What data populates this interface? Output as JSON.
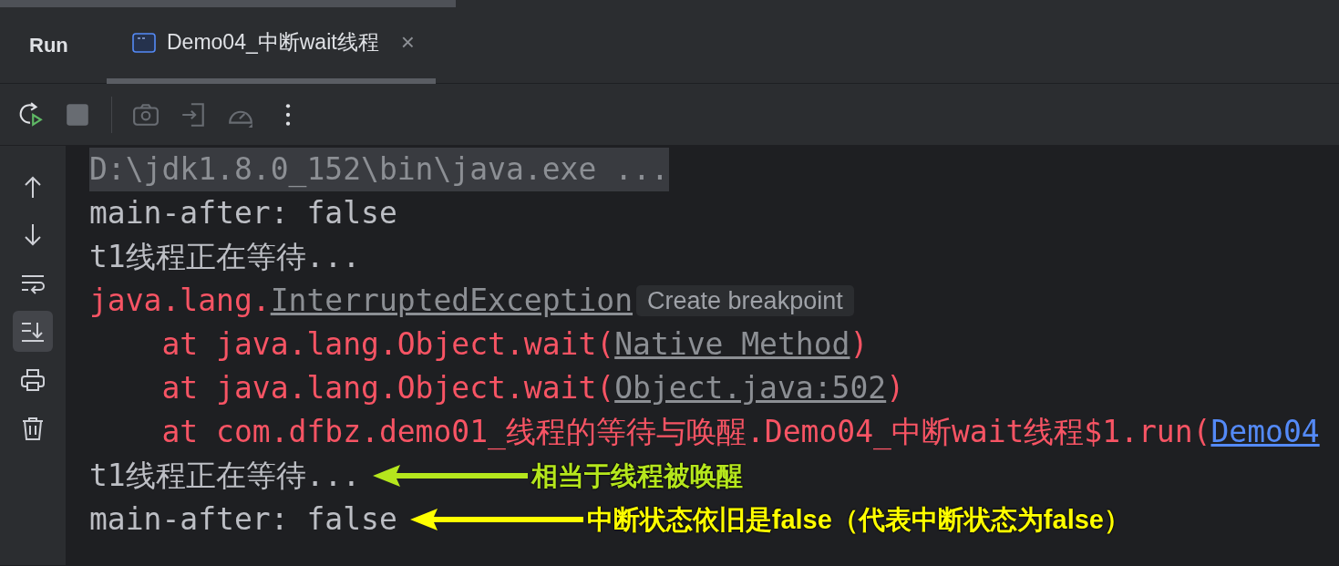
{
  "panel_title": "Run",
  "tabs": [
    {
      "label": "Demo04_中断wait线程",
      "selected": true,
      "close": "×"
    }
  ],
  "toolbar": [
    {
      "kind": "rerun",
      "disabled": false
    },
    {
      "kind": "stop",
      "disabled": true
    },
    {
      "kind": "separator"
    },
    {
      "kind": "camera",
      "disabled": true
    },
    {
      "kind": "exit",
      "disabled": true
    },
    {
      "kind": "gauge",
      "disabled": true
    },
    {
      "kind": "more",
      "disabled": false
    }
  ],
  "gutter": [
    {
      "kind": "up",
      "selected": false
    },
    {
      "kind": "down",
      "selected": false
    },
    {
      "kind": "wrap",
      "selected": false
    },
    {
      "kind": "scroll-end",
      "selected": true
    },
    {
      "kind": "print",
      "selected": false
    },
    {
      "kind": "trash",
      "selected": false
    }
  ],
  "console": [
    {
      "segments": [
        {
          "kind": "command",
          "text": "D:\\jdk1.8.0_152\\bin\\java.exe ..."
        }
      ]
    },
    {
      "segments": [
        {
          "kind": "plain",
          "text": "main-after: false"
        }
      ]
    },
    {
      "segments": [
        {
          "kind": "plain",
          "text": "t1线程正在等待..."
        }
      ]
    },
    {
      "segments": [
        {
          "kind": "error",
          "text": "java.lang."
        },
        {
          "kind": "link",
          "text": "InterruptedException"
        },
        {
          "kind": "hint",
          "text": "Create breakpoint"
        }
      ]
    },
    {
      "segments": [
        {
          "kind": "error",
          "text": "    at java.lang.Object.wait("
        },
        {
          "kind": "link",
          "text": "Native Method"
        },
        {
          "kind": "error",
          "text": ")"
        }
      ]
    },
    {
      "segments": [
        {
          "kind": "error",
          "text": "    at java.lang.Object.wait("
        },
        {
          "kind": "link",
          "text": "Object.java:502"
        },
        {
          "kind": "error",
          "text": ")"
        }
      ]
    },
    {
      "segments": [
        {
          "kind": "error",
          "text": "    at com.dfbz.demo01_线程的等待与唤醒.Demo04_中断wait线程$1.run("
        },
        {
          "kind": "hyperlink",
          "text": "Demo04"
        }
      ]
    },
    {
      "segments": [
        {
          "kind": "plain",
          "text": "t1线程正在等待..."
        }
      ],
      "annotation": {
        "text": "相当于线程被唤醒",
        "color": "#b5e61d"
      }
    },
    {
      "segments": [
        {
          "kind": "plain",
          "text": "main-after: false"
        }
      ],
      "annotation": {
        "text": "中断状态依旧是false（代表中断状态为false）",
        "color": "#ffff00"
      }
    }
  ]
}
